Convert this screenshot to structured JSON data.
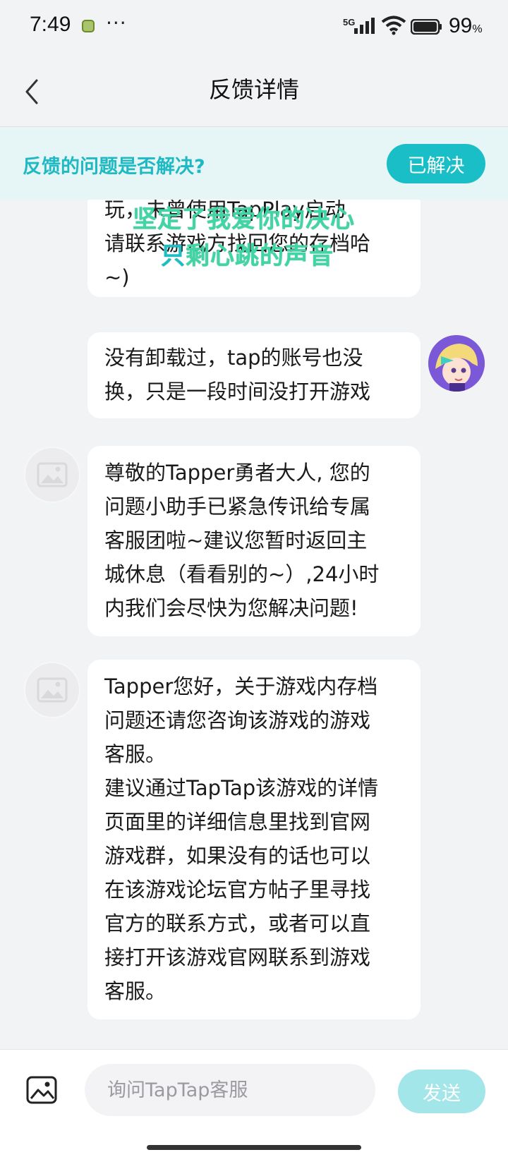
{
  "status_bar": {
    "time": "7:49",
    "more": "···",
    "network": "5G",
    "battery_percent": "99",
    "percent_sign": "%"
  },
  "nav": {
    "title": "反馈详情"
  },
  "resolve": {
    "question": "反馈的问题是否解决?",
    "button": "已解决"
  },
  "overlay": {
    "line1": "坚定了我爱你的决心",
    "line2_a": "只",
    "line2_b": "剩心跳的声音"
  },
  "messages": [
    {
      "from": "support",
      "text": "玩，未曾使用TapPlay启动\n请联系游戏方找回您的存档哈\n~)"
    },
    {
      "from": "user",
      "text": "没有卸载过，tap的账号也没\n换，只是一段时间没打开游戏"
    },
    {
      "from": "support",
      "text": "尊敬的Tapper勇者大人, 您的\n问题小助手已紧急传讯给专属\n客服团啦~建议您暂时返回主\n城休息（看看别的~）,24小时\n内我们会尽快为您解决问题!"
    },
    {
      "from": "support",
      "text": "Tapper您好，关于游戏内存档\n问题还请您咨询该游戏的游戏\n客服。\n建议通过TapTap该游戏的详情\n页面里的详细信息里找到官网\n游戏群，如果没有的话也可以\n在该游戏论坛官方帖子里寻找\n官方的联系方式，或者可以直\n接打开该游戏官网联系到游戏\n客服。"
    }
  ],
  "input": {
    "placeholder": "询问TapTap客服",
    "value": "",
    "send_label": "发送"
  },
  "colors": {
    "accent": "#19bec6",
    "resolve_bg": "#e6f6f6",
    "send_disabled": "#a3e6e9",
    "lyric": "#3fd6a6"
  }
}
